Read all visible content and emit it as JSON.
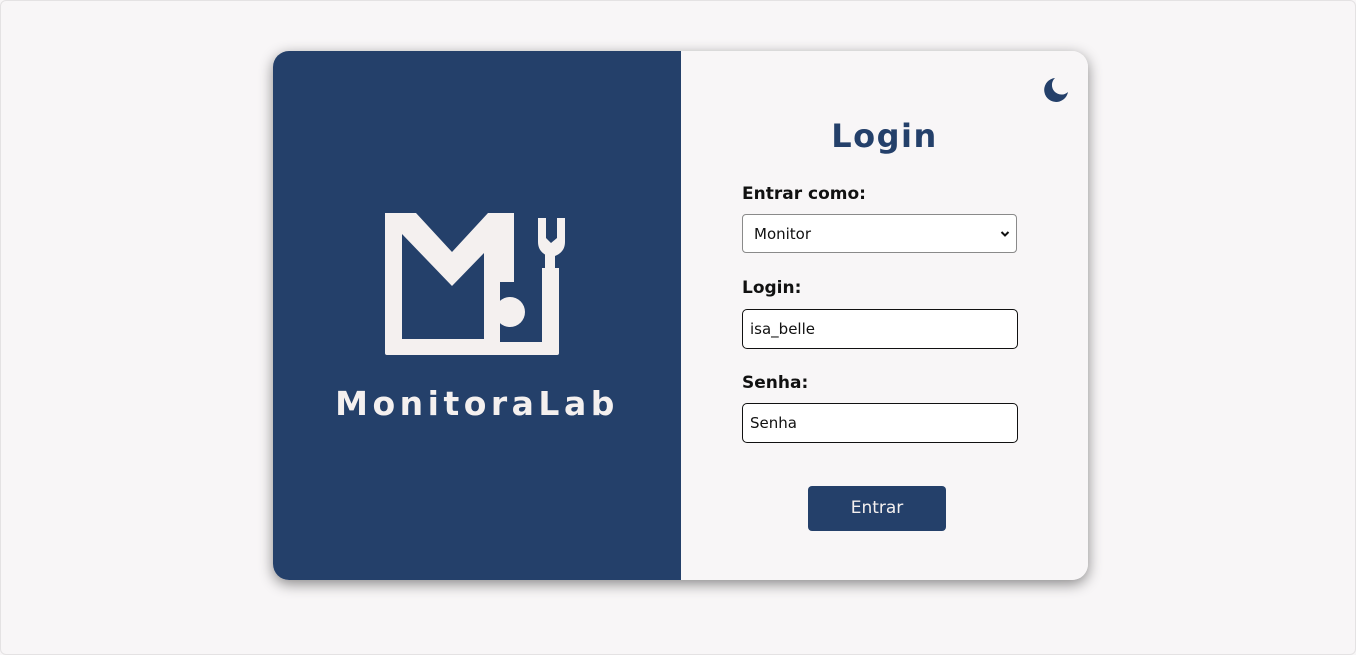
{
  "brand": {
    "name": "MonitoraLab",
    "logo_icon": "monitoralab-logo-icon"
  },
  "theme_toggle": {
    "icon": "moon-icon"
  },
  "form": {
    "title": "Login",
    "role_label": "Entrar como:",
    "role_selected": "Monitor",
    "login_label": "Login:",
    "login_value": "isa_belle",
    "password_label": "Senha:",
    "password_placeholder": "Senha",
    "submit_label": "Entrar"
  },
  "colors": {
    "primary": "#24406a",
    "background": "#f8f6f7",
    "logo": "#f4f0ef"
  }
}
